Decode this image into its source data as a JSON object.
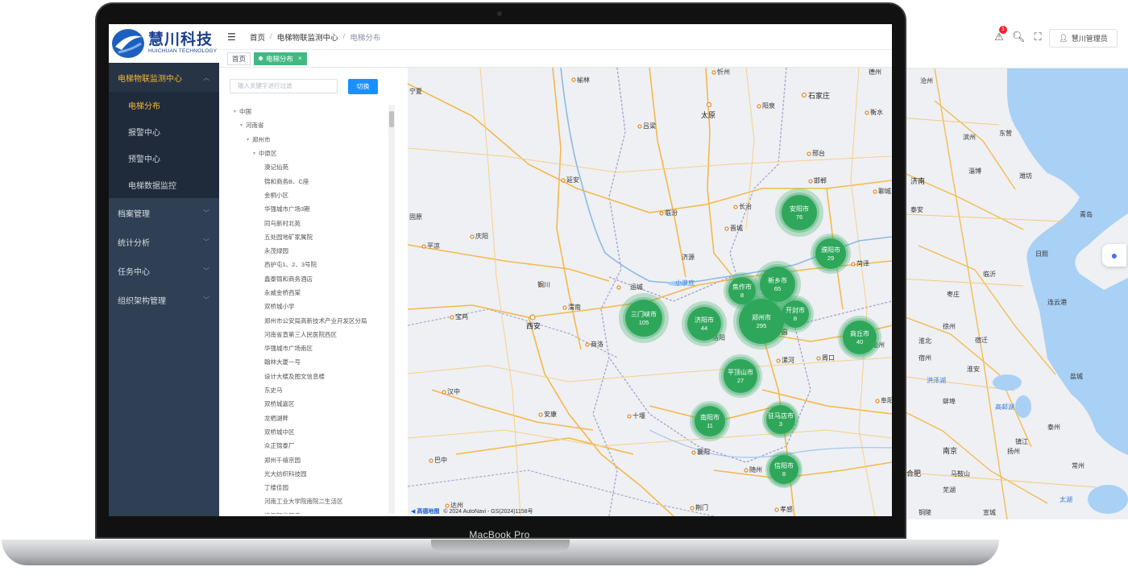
{
  "logo": {
    "cn": "慧川科技",
    "en": "HUICHUAN TECHNOLOGY"
  },
  "sidebar": {
    "groups": [
      {
        "label": "电梯物联监测中心",
        "active": true,
        "children": [
          {
            "label": "电梯分布",
            "active": true
          },
          {
            "label": "报警中心"
          },
          {
            "label": "预警中心"
          },
          {
            "label": "电梯数据监控"
          }
        ]
      },
      {
        "label": "档案管理"
      },
      {
        "label": "统计分析"
      },
      {
        "label": "任务中心"
      },
      {
        "label": "组织架构管理"
      }
    ]
  },
  "breadcrumb": [
    "首页",
    "电梯物联监测中心",
    "电梯分布"
  ],
  "tags": [
    {
      "label": "首页"
    },
    {
      "label": "电梯分布",
      "active": true
    }
  ],
  "filter": {
    "placeholder": "输入关键字进行过滤",
    "button": "切换"
  },
  "tree": {
    "root": "中国",
    "province": "河南省",
    "city": "郑州市",
    "district": "中原区",
    "items": [
      "澳记仙苑",
      "锦和商务B、C座",
      "金桐小区",
      "华强城市广场3期",
      "同乌新村北苑",
      "五处园地矿家属院",
      "永茂绿园",
      "西护屯1、2、3号院",
      "鑫泰锦和商务酒店",
      "永威金桥西棠",
      "双桥城小学",
      "郑州市公安局高新技术产业开发区分局",
      "河南省直第三人民医院西区",
      "华强城市广场南区",
      "翰林大厦一号",
      "设计大楼及图文信息楼",
      "东史马",
      "双桥城嘉区",
      "龙栖湖畔",
      "双桥城中区",
      "众正锦泰厂",
      "郑州千禧京园",
      "光大纺织科技园",
      "丁楼佳园",
      "河南工业大学院南院二生活区",
      "清源智能厂房"
    ]
  },
  "clusters": [
    {
      "name": "安阳市",
      "count": "76"
    },
    {
      "name": "濮阳市",
      "count": "29"
    },
    {
      "name": "新乡市",
      "count": "65"
    },
    {
      "name": "焦作市",
      "count": "8"
    },
    {
      "name": "开封市",
      "count": "8"
    },
    {
      "name": "三门峡市",
      "count": "105"
    },
    {
      "name": "济阳市",
      "count": "44"
    },
    {
      "name": "郑州市",
      "count": "295"
    },
    {
      "name": "商丘市",
      "count": "40"
    },
    {
      "name": "平顶山市",
      "count": "27"
    },
    {
      "name": "南阳市",
      "count": "11"
    },
    {
      "name": "驻马店市",
      "count": "3"
    },
    {
      "name": "信阳市",
      "count": "8"
    }
  ],
  "map_cities": [
    "榆林",
    "忻州",
    "石家庄",
    "衡水",
    "吕梁",
    "太原",
    "阳泉",
    "邢台",
    "延安",
    "临汾",
    "长治",
    "邯郸",
    "聊城",
    "庆阳",
    "平凉",
    "铜川",
    "渭南",
    "西安",
    "宝鸡",
    "商洛",
    "运城",
    "汉中",
    "安康",
    "十堰",
    "巴中",
    "达州",
    "襄阳",
    "随州",
    "荆门",
    "孝感",
    "菏泽",
    "许昌",
    "漯河",
    "周口",
    "亳州",
    "阜阳",
    "固原",
    "宁夏",
    "洛阳",
    "晋城",
    "济源",
    "鹤壁",
    "德州",
    "小浪底"
  ],
  "outer_map_cities": [
    "沧州",
    "滨州",
    "东营",
    "济南",
    "淄博",
    "潍坊",
    "青岛",
    "日照",
    "临沂",
    "枣庄",
    "徐州",
    "连云港",
    "宿迁",
    "盐城",
    "淮安",
    "淮北",
    "泰安",
    "济宁",
    "宿州",
    "蚌埠",
    "南京",
    "合肥",
    "马鞍山",
    "芜湖",
    "镇江",
    "常州",
    "泰州",
    "扬州",
    "铜陵",
    "宣城",
    "六安",
    "洪泽湖",
    "高邮湖",
    "太湖"
  ],
  "map_footer": {
    "brand": "高德地图",
    "copyright": "© 2024 AutoNavi - GS(2024)1158号"
  },
  "header_right": {
    "user": "慧川管理员",
    "badge": "1"
  },
  "device": {
    "label": "MacBook Pro"
  }
}
